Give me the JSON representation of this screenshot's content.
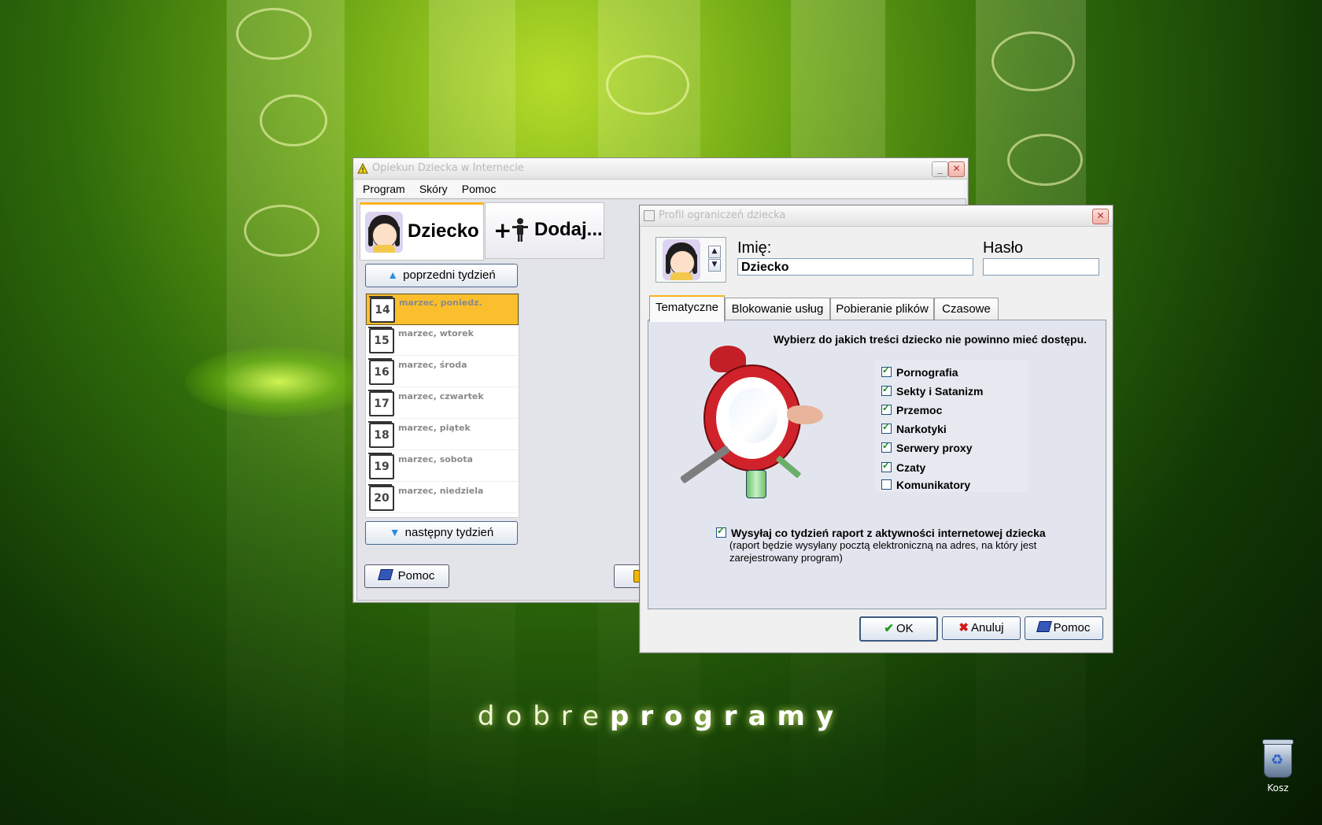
{
  "desktop": {
    "brand_light": "dobre",
    "brand_bold": "programy",
    "recycle_bin_label": "Kosz"
  },
  "main_window": {
    "title": "Opiekun Dziecka w Internecie",
    "menu": [
      "Program",
      "Skóry",
      "Pomoc"
    ],
    "profile_tabs": [
      {
        "label": "Dziecko",
        "icon": "child-avatar-icon"
      },
      {
        "label": "Dodaj...",
        "icon": "add-person-icon"
      }
    ],
    "prev_week_label": "poprzedni tydzień",
    "next_week_label": "następny tydzień",
    "days": [
      {
        "num": "14",
        "label": "marzec, poniedz."
      },
      {
        "num": "15",
        "label": "marzec, wtorek"
      },
      {
        "num": "16",
        "label": "marzec, środa"
      },
      {
        "num": "17",
        "label": "marzec, czwartek"
      },
      {
        "num": "18",
        "label": "marzec, piątek"
      },
      {
        "num": "19",
        "label": "marzec, sobota"
      },
      {
        "num": "20",
        "label": "marzec, niedziela"
      }
    ],
    "selected_day_index": 0,
    "help_label": "Pomoc"
  },
  "profile_dialog": {
    "title": "Profil ograniczeń dziecka",
    "name_label": "Imię:",
    "name_value": "Dziecko",
    "password_label": "Hasło",
    "password_value": "",
    "tabs": [
      "Tematyczne",
      "Blokowanie usług",
      "Pobieranie plików",
      "Czasowe"
    ],
    "active_tab": "Tematyczne",
    "prompt": "Wybierz do jakich treści dziecko nie powinno mieć dostępu.",
    "categories": [
      {
        "label": "Pornografia",
        "checked": true
      },
      {
        "label": "Sekty i Satanizm",
        "checked": true
      },
      {
        "label": "Przemoc",
        "checked": true
      },
      {
        "label": "Narkotyki",
        "checked": true
      },
      {
        "label": "Serwery proxy",
        "checked": true
      },
      {
        "label": "Czaty",
        "checked": true
      },
      {
        "label": "Komunikatory",
        "checked": false
      }
    ],
    "report_checked": true,
    "report_label": "Wysyłaj co tydzień raport z aktywności internetowej dziecka",
    "report_note": "(raport będzie wysyłany pocztą elektroniczną na adres, na który jest zarejestrowany program)",
    "ok_label": "OK",
    "cancel_label": "Anuluj",
    "help_label": "Pomoc"
  },
  "colors": {
    "accent_tab": "#ffb31a",
    "selected_day": "#fbbf2e",
    "stop_sign_red": "#d0222a"
  }
}
